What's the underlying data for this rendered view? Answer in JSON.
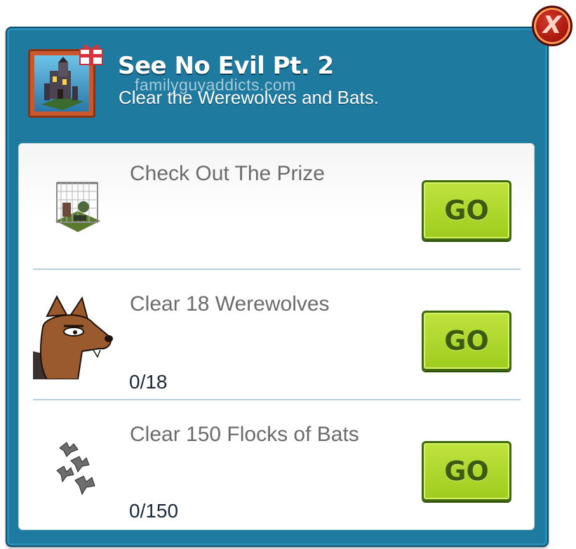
{
  "close_button": {
    "label": "X",
    "icon": "close-icon",
    "color": "#a9180f"
  },
  "header": {
    "title": "See No Evil Pt. 2",
    "subtitle": "Clear the Werewolves and Bats.",
    "watermark": "familyguyaddicts.com",
    "thumbnail_icon": "haunted-house-icon",
    "gift_icon": "gift-icon"
  },
  "tasks": [
    {
      "label": "Check Out The Prize",
      "progress": "",
      "icon": "prize-building-icon",
      "button": "GO"
    },
    {
      "label": "Clear 18 Werewolves",
      "progress": "0/18",
      "icon": "werewolf-icon",
      "button": "GO"
    },
    {
      "label": "Clear 150 Flocks of Bats",
      "progress": "0/150",
      "icon": "bats-icon",
      "button": "GO"
    }
  ],
  "colors": {
    "dialog_bg": "#1f7aa0",
    "go_button": "#a8d62a",
    "go_text": "#3d5b10"
  }
}
